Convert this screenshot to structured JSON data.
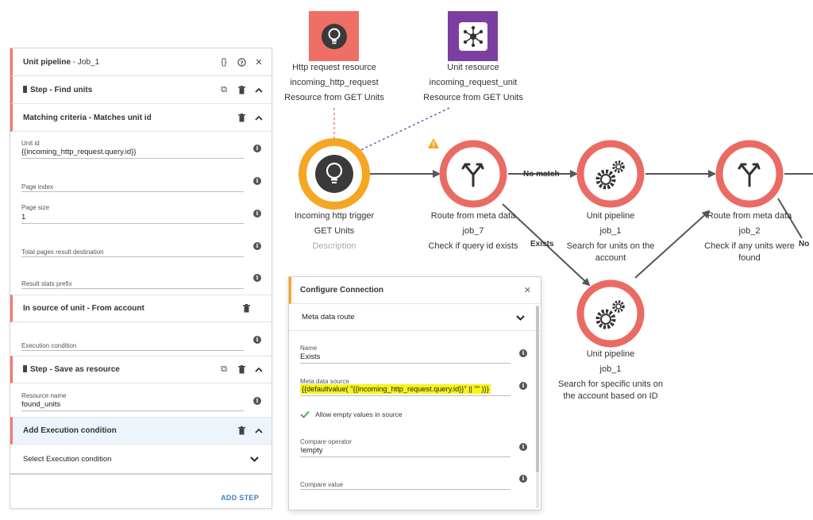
{
  "left_panel": {
    "header": {
      "title": "Unit pipeline",
      "subtitle": "- Job_1",
      "json_icon": "{}"
    },
    "step_find": {
      "label": "Step - Find units"
    },
    "criteria": {
      "label": "Matching criteria - Matches unit id"
    },
    "fields": [
      {
        "label": "Unit id",
        "value": "{{incoming_http_request.query.id}}"
      },
      {
        "label": "Page index",
        "value": ""
      },
      {
        "label": "Page size",
        "value": "1"
      },
      {
        "label": "Total pages result destination",
        "value": ""
      },
      {
        "label": "Result stats prefix",
        "value": ""
      }
    ],
    "in_source": {
      "label": "In source of unit - From account"
    },
    "execution_condition": {
      "label": "Execution condition"
    },
    "step_save": {
      "label": "Step - Save as resource"
    },
    "resource_name": {
      "label": "Resource name",
      "value": "found_units"
    },
    "add_execution": {
      "label": "Add Execution condition"
    },
    "select_execution": {
      "label": "Select Execution condition"
    },
    "add_step": "ADD STEP"
  },
  "flow": {
    "resources": [
      {
        "title": "Http request resource",
        "name": "incoming_http_request",
        "desc": "Resource from GET Units",
        "color": "#ef6e66"
      },
      {
        "title": "Unit resource",
        "name": "incoming_request_unit",
        "desc": "Resource from GET Units",
        "color": "#7b3fa0"
      }
    ],
    "trigger": {
      "title": "Incoming http trigger",
      "sub": "GET Units",
      "desc": "Description"
    },
    "route1": {
      "title": "Route from meta data",
      "sub": "job_7",
      "desc": "Check if query id exists"
    },
    "pipeline1": {
      "title": "Unit pipeline",
      "sub": "job_1",
      "desc1": "Search for units on the",
      "desc2": "account"
    },
    "route2": {
      "title": "Route from meta data",
      "sub": "job_2",
      "desc1": "Check if any units were",
      "desc2": "found"
    },
    "pipeline2": {
      "title": "Unit pipeline",
      "sub": "job_1",
      "desc1": "Search for specific units on",
      "desc2": "the account based on ID"
    },
    "edges": {
      "no_match": "No match",
      "exists": "Exists",
      "no_cut": "No"
    },
    "colors": {
      "trigger": "#f5a623",
      "node": "#ea6b63",
      "warning": "#f5a623"
    }
  },
  "dialog": {
    "title": "Configure Connection",
    "route_type": "Meta data route",
    "name": {
      "label": "Name",
      "value": "Exists"
    },
    "meta_source": {
      "label": "Meta data source",
      "value": "{{defaultvalue( \"{{incoming_http_request.query.id}}\" || \"\" )}}"
    },
    "allow_empty": "Allow empty values in source",
    "compare_operator": {
      "label": "Compare operator",
      "value": "!empty"
    },
    "compare_value": {
      "label": "Compare value",
      "value": ""
    }
  }
}
